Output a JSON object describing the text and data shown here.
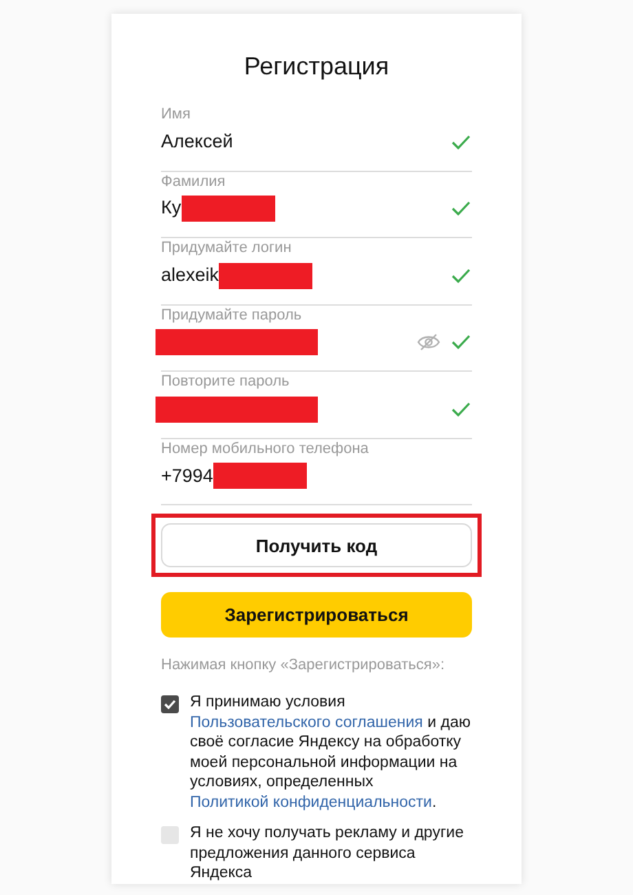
{
  "title": "Регистрация",
  "fields": [
    {
      "label": "Имя",
      "value": "Алексей",
      "valid": true
    },
    {
      "label": "Фамилия",
      "value": "Ку",
      "redacted": true,
      "valid": true
    },
    {
      "label": "Придумайте логин",
      "value": "alexeik",
      "redacted": true,
      "valid": true
    },
    {
      "label": "Придумайте пароль",
      "redacted": true,
      "valid": true,
      "eye_toggle": true
    },
    {
      "label": "Повторите пароль",
      "redacted": true,
      "valid": true
    },
    {
      "label": "Номер мобильного телефона",
      "value": "+7994",
      "redacted": true
    }
  ],
  "code_button": {
    "label": "Получить код",
    "highlighted": true
  },
  "register_button": {
    "label": "Зарегистрироваться"
  },
  "note": "Нажимая кнопку «Зарегистрироваться»:",
  "checkboxes": [
    {
      "checked": true,
      "parts": [
        {
          "text": "Я принимаю условия ",
          "link": false
        },
        {
          "text": "Пользовательского соглашения",
          "link": true
        },
        {
          "text": " и даю своё согласие Яндексу на обработку моей персональной информации на условиях, определенных ",
          "link": false
        },
        {
          "text": "Политикой конфиденциальности",
          "link": true
        },
        {
          "text": ".",
          "link": false
        }
      ]
    },
    {
      "checked": false,
      "parts": [
        {
          "text": "Я не хочу получать рекламу и другие предложения данного сервиса Яндекса",
          "link": false
        }
      ]
    }
  ]
}
